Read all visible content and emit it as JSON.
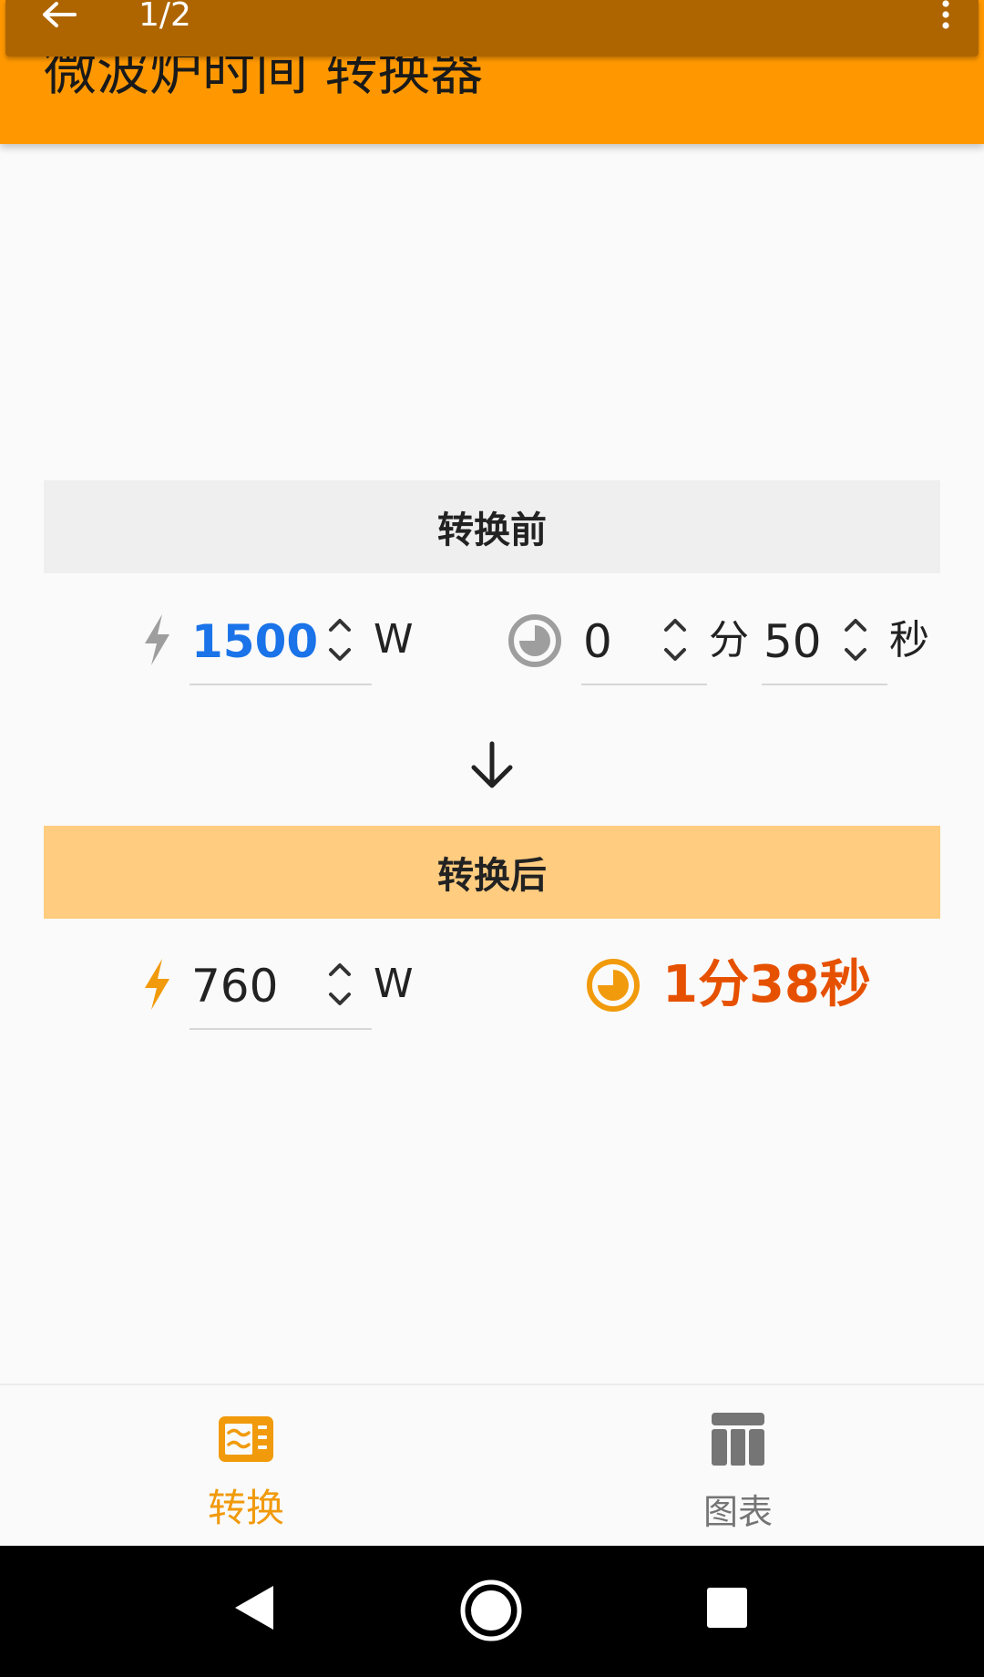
{
  "status_bar": {
    "counter": "1/2"
  },
  "app_bar": {
    "title": "微波炉时间 转换器",
    "color": "#ff9800"
  },
  "before": {
    "header": "转换前",
    "power": {
      "value": "1500",
      "unit": "W",
      "icon": "lightning-icon"
    },
    "minutes": {
      "value": "0",
      "unit": "分"
    },
    "seconds": {
      "value": "50",
      "unit": "秒"
    },
    "accent_color": "#1a73e8"
  },
  "after": {
    "header": "转换后",
    "power": {
      "value": "760",
      "unit": "W",
      "icon": "lightning-icon"
    },
    "result": "1分38秒",
    "accent_color": "#e65100"
  },
  "bottom_nav": {
    "items": [
      {
        "label": "转换",
        "icon": "microwave-icon",
        "active": true
      },
      {
        "label": "图表",
        "icon": "table-icon",
        "active": false
      }
    ],
    "active_color": "#f19a0b",
    "inactive_color": "#757575"
  }
}
